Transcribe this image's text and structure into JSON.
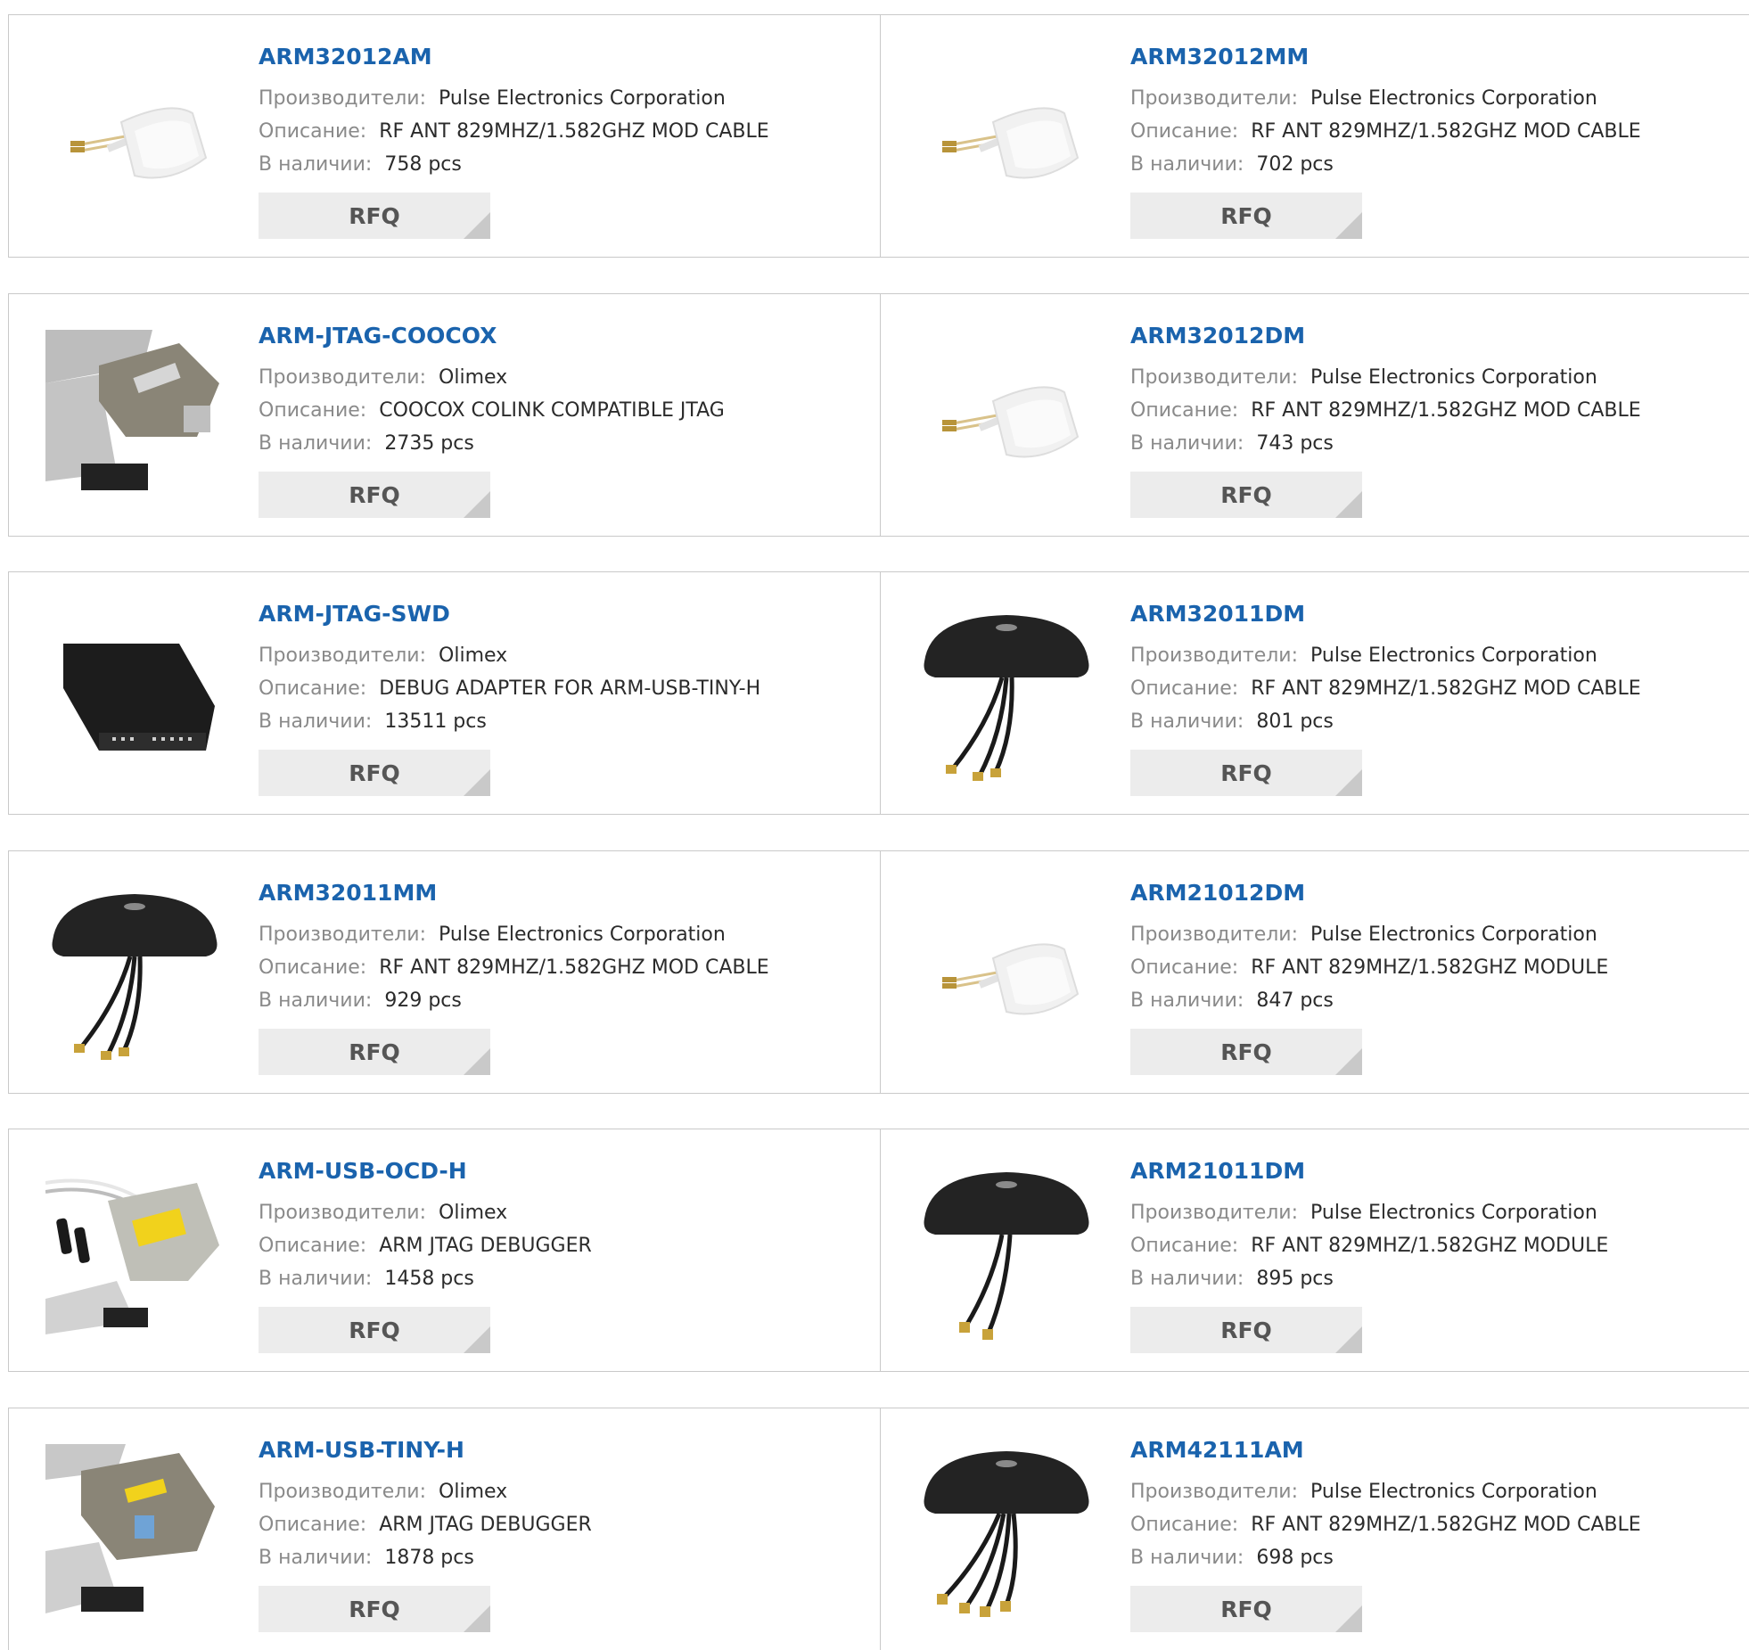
{
  "labels": {
    "manufacturer": "Производители:",
    "description": "Описание:",
    "stock": "В наличии:",
    "rfq": "RFQ"
  },
  "products": [
    {
      "pn": "ARM32012AM",
      "mfr": "Pulse Electronics Corporation",
      "desc": "RF ANT 829MHZ/1.582GHZ MOD CABLE",
      "stock": "758 pcs",
      "image": "white-antenna-module-icon"
    },
    {
      "pn": "ARM32012MM",
      "mfr": "Pulse Electronics Corporation",
      "desc": "RF ANT 829MHZ/1.582GHZ MOD CABLE",
      "stock": "702 pcs",
      "image": "white-antenna-module-icon"
    },
    {
      "pn": "ARM-JTAG-COOCOX",
      "mfr": "Olimex",
      "desc": "COOCOX COLINK COMPATIBLE JTAG",
      "stock": "2735 pcs",
      "image": "jtag-adapter-ribbon-icon"
    },
    {
      "pn": "ARM32012DM",
      "mfr": "Pulse Electronics Corporation",
      "desc": "RF ANT 829MHZ/1.582GHZ MOD CABLE",
      "stock": "743 pcs",
      "image": "white-antenna-module-icon"
    },
    {
      "pn": "ARM-JTAG-SWD",
      "mfr": "Olimex",
      "desc": "DEBUG ADAPTER FOR ARM-USB-TINY-H",
      "stock": "13511 pcs",
      "image": "black-debug-adapter-icon"
    },
    {
      "pn": "ARM32011DM",
      "mfr": "Pulse Electronics Corporation",
      "desc": "RF ANT 829MHZ/1.582GHZ MOD CABLE",
      "stock": "801 pcs",
      "image": "black-antenna-3cable-icon"
    },
    {
      "pn": "ARM32011MM",
      "mfr": "Pulse Electronics Corporation",
      "desc": "RF ANT 829MHZ/1.582GHZ MOD CABLE",
      "stock": "929 pcs",
      "image": "black-antenna-3cable-icon"
    },
    {
      "pn": "ARM21012DM",
      "mfr": "Pulse Electronics Corporation",
      "desc": "RF ANT 829MHZ/1.582GHZ MODULE",
      "stock": "847 pcs",
      "image": "white-antenna-module-icon"
    },
    {
      "pn": "ARM-USB-OCD-H",
      "mfr": "Olimex",
      "desc": "ARM JTAG DEBUGGER",
      "stock": "1458 pcs",
      "image": "jtag-debugger-db9-icon"
    },
    {
      "pn": "ARM21011DM",
      "mfr": "Pulse Electronics Corporation",
      "desc": "RF ANT 829MHZ/1.582GHZ MODULE",
      "stock": "895 pcs",
      "image": "black-antenna-2cable-icon"
    },
    {
      "pn": "ARM-USB-TINY-H",
      "mfr": "Olimex",
      "desc": "ARM JTAG DEBUGGER",
      "stock": "1878 pcs",
      "image": "jtag-debugger-usb-icon"
    },
    {
      "pn": "ARM42111AM",
      "mfr": "Pulse Electronics Corporation",
      "desc": "RF ANT 829MHZ/1.582GHZ MOD CABLE",
      "stock": "698 pcs",
      "image": "black-antenna-4cable-icon"
    }
  ],
  "colors": {
    "part_number": "#1a63ad",
    "label": "#8a8a8a",
    "value": "#2b2b2b",
    "rfq_bg": "#ececec",
    "border": "#c9c9c9"
  }
}
